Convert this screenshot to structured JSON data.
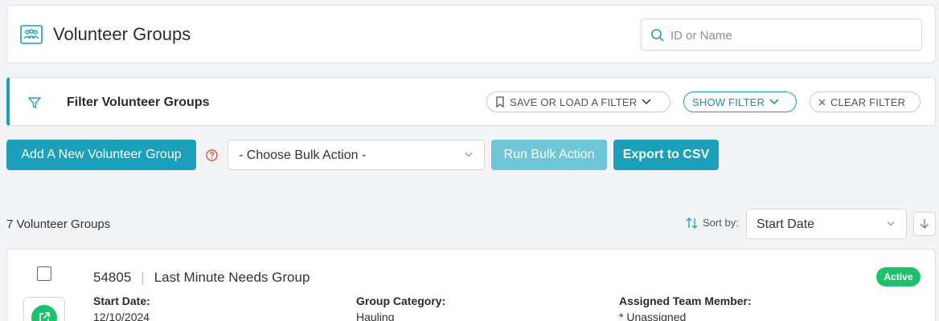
{
  "header": {
    "title": "Volunteer Groups",
    "search_placeholder": "ID or Name",
    "icon": "volunteer-groups-icon"
  },
  "filter": {
    "title": "Filter Volunteer Groups",
    "save_load_label": "SAVE OR LOAD A FILTER",
    "show_filter_label": "SHOW FILTER",
    "clear_filter_label": "CLEAR FILTER"
  },
  "actions": {
    "add_label": "Add A New Volunteer Group",
    "bulk_action_selected": "- Choose Bulk Action -",
    "run_bulk_label": "Run Bulk Action",
    "export_label": "Export to CSV"
  },
  "results": {
    "count_text": "7 Volunteer Groups",
    "sort_label": "Sort by:",
    "sort_selected": "Start Date"
  },
  "groups": [
    {
      "id": "54805",
      "name": "Last Minute Needs Group",
      "status": "Active",
      "fields": [
        {
          "label": "Start Date:",
          "value": "12/10/2024"
        },
        {
          "label": "Group Category:",
          "value": "Hauling"
        },
        {
          "label": "Assigned Team Member:",
          "value": "* Unassigned"
        }
      ]
    }
  ],
  "colors": {
    "accent": "#1aa0ba",
    "accent_light": "#6fc6d6",
    "active_green": "#1fbf6b",
    "help_orange": "#e8582b"
  }
}
